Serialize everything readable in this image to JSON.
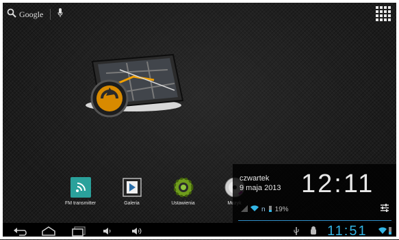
{
  "search": {
    "label": "Google",
    "voice_icon": "mic-icon",
    "search_icon": "search-icon"
  },
  "all_apps_icon": "grid-icon",
  "dock": {
    "apps": [
      {
        "label": "FM transmitter",
        "icon": "wifi-broadcast-icon"
      },
      {
        "label": "Galeria",
        "icon": "film-play-icon"
      },
      {
        "label": "Ustawienia",
        "icon": "gear-icon"
      },
      {
        "label": "Muzyk",
        "icon": "cd-icon"
      }
    ]
  },
  "notification_panel": {
    "day": "czwartek",
    "date": "9 maja 2013",
    "time": "12:11",
    "network_type": "n",
    "battery": "19%"
  },
  "system_bar": {
    "time": "11:51"
  },
  "colors": {
    "accent": "#33b5e5",
    "background": "#1b1b1b"
  }
}
